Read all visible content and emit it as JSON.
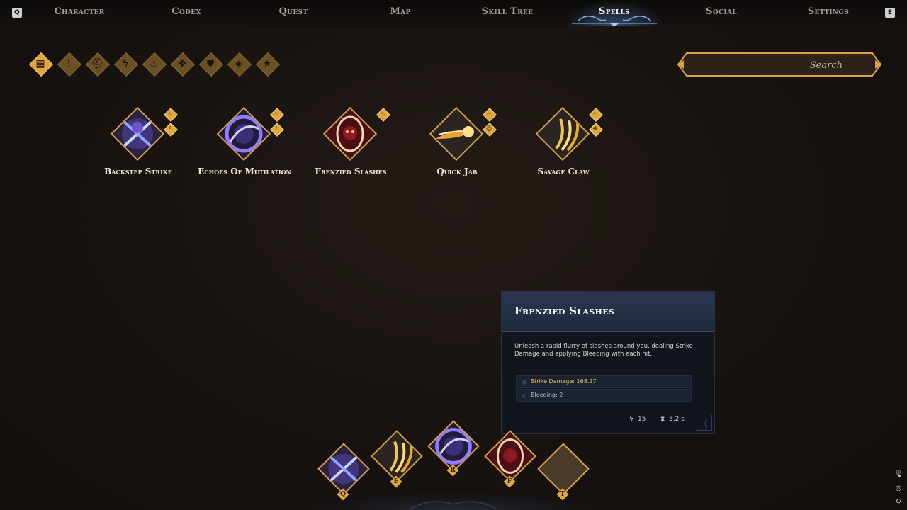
{
  "nav": {
    "left_key": "Q",
    "right_key": "E",
    "tabs": [
      {
        "label": "Character"
      },
      {
        "label": "Codex"
      },
      {
        "label": "Quest"
      },
      {
        "label": "Map"
      },
      {
        "label": "Skill Tree"
      },
      {
        "label": "Spells",
        "active": true
      },
      {
        "label": "Social"
      },
      {
        "label": "Settings"
      }
    ]
  },
  "filters": [
    {
      "icon": "all-grid-icon",
      "active": true
    },
    {
      "icon": "exclamation-icon"
    },
    {
      "icon": "helmet-icon"
    },
    {
      "icon": "lightning-icon"
    },
    {
      "icon": "fire-icon"
    },
    {
      "icon": "compass-star-icon"
    },
    {
      "icon": "shield-icon"
    },
    {
      "icon": "gem-icon"
    },
    {
      "icon": "star-icon"
    }
  ],
  "search": {
    "placeholder": "Search"
  },
  "spells": [
    {
      "name": "Backstep Strike",
      "art": "crossed-blades-purple",
      "badges": [
        "fire-icon",
        "exclamation-icon"
      ]
    },
    {
      "name": "Echoes Of Mutilation",
      "art": "purple-vortex",
      "badges": [
        "fire-icon",
        "exclamation-icon"
      ]
    },
    {
      "name": "Frenzied Slashes",
      "art": "red-claw-portrait",
      "badges": [
        "fire-icon"
      ]
    },
    {
      "name": "Quick Jab",
      "art": "golden-fireball",
      "badges": [
        "fire-icon",
        "helmet-icon"
      ]
    },
    {
      "name": "Savage Claw",
      "art": "golden-claw-slash",
      "badges": [
        "fire-icon",
        "compass-star-icon"
      ]
    }
  ],
  "tooltip": {
    "title": "Frenzied Slashes",
    "description": "Unleash a rapid flurry of slashes around you, dealing Strike Damage and applying Bleeding with each hit.",
    "stats": [
      {
        "label": "Strike Damage: 168.27",
        "tone": "gold"
      },
      {
        "label": "Bleeding: 2",
        "tone": "grey"
      }
    ],
    "energy_cost": "15",
    "cooldown": "5.2 s"
  },
  "hotbar": [
    {
      "key": "Q",
      "art": "crossed-blades-purple"
    },
    {
      "key": "E",
      "art": "golden-claw-slash"
    },
    {
      "key": "R",
      "art": "purple-vortex"
    },
    {
      "key": "F",
      "art": "red-claw-portrait"
    },
    {
      "key": "T",
      "art": "empty"
    }
  ],
  "colors": {
    "accent_gold": "#e0a640",
    "active_tab_glow": "#5a8cd2",
    "tooltip_header": "#2a3650"
  }
}
